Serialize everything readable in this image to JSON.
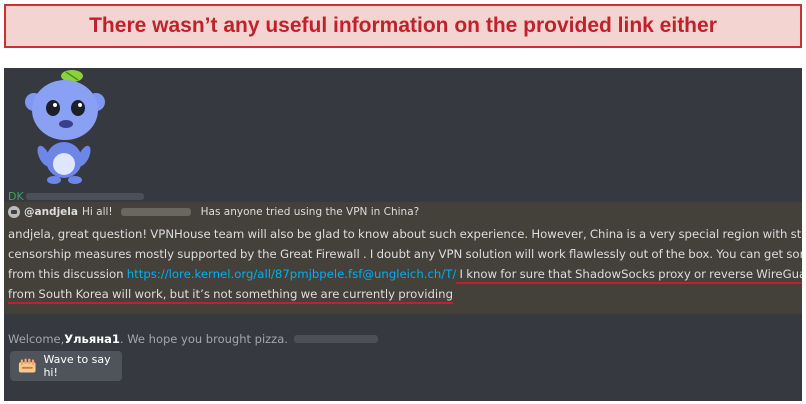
{
  "banner": {
    "text": "There wasn’t any useful information on the provided link either"
  },
  "chat": {
    "author_initials": "DK",
    "reply": {
      "username": "@andjela",
      "greeting": "Hi all!",
      "question": "Has anyone tried using the VPN in China?"
    },
    "message_lines": {
      "l1": "andjela, great question! VPNHouse team will also be glad to know about such experience. However, China is a very special region with strict",
      "l2": "censorship measures mostly supported by the Great Firewall . I doubt any VPN solution will work flawlessly out of the box. You can get some info",
      "l3_pre": "from this discussion ",
      "l3_link": "https://lore.kernel.org/all/87pmjbpele.fsf@ungleich.ch/T/",
      "l3_post": " I know for sure that ShadowSocks proxy or reverse WireGuard tunnel",
      "l4": "from South Korea will work, but it’s not something we are currently providing"
    },
    "welcome": {
      "prefix": "Welcome, ",
      "name": "Ульяна1",
      "suffix": ". We hope you brought pizza."
    },
    "wave_button_label": "Wave to say hi!"
  },
  "colors": {
    "banner_bg": "#f4d4d1",
    "banner_border": "#c9332f",
    "banner_text": "#c0222b",
    "panel_bg": "#36393f",
    "highlight_bg": "#44413a",
    "link": "#00aff4",
    "author": "#3ba55d",
    "annotation_underline": "#c0222b"
  },
  "icons": {
    "mascot": "wumpus-mascot",
    "reply": "reply-icon",
    "wave": "wave-sticker-icon"
  }
}
